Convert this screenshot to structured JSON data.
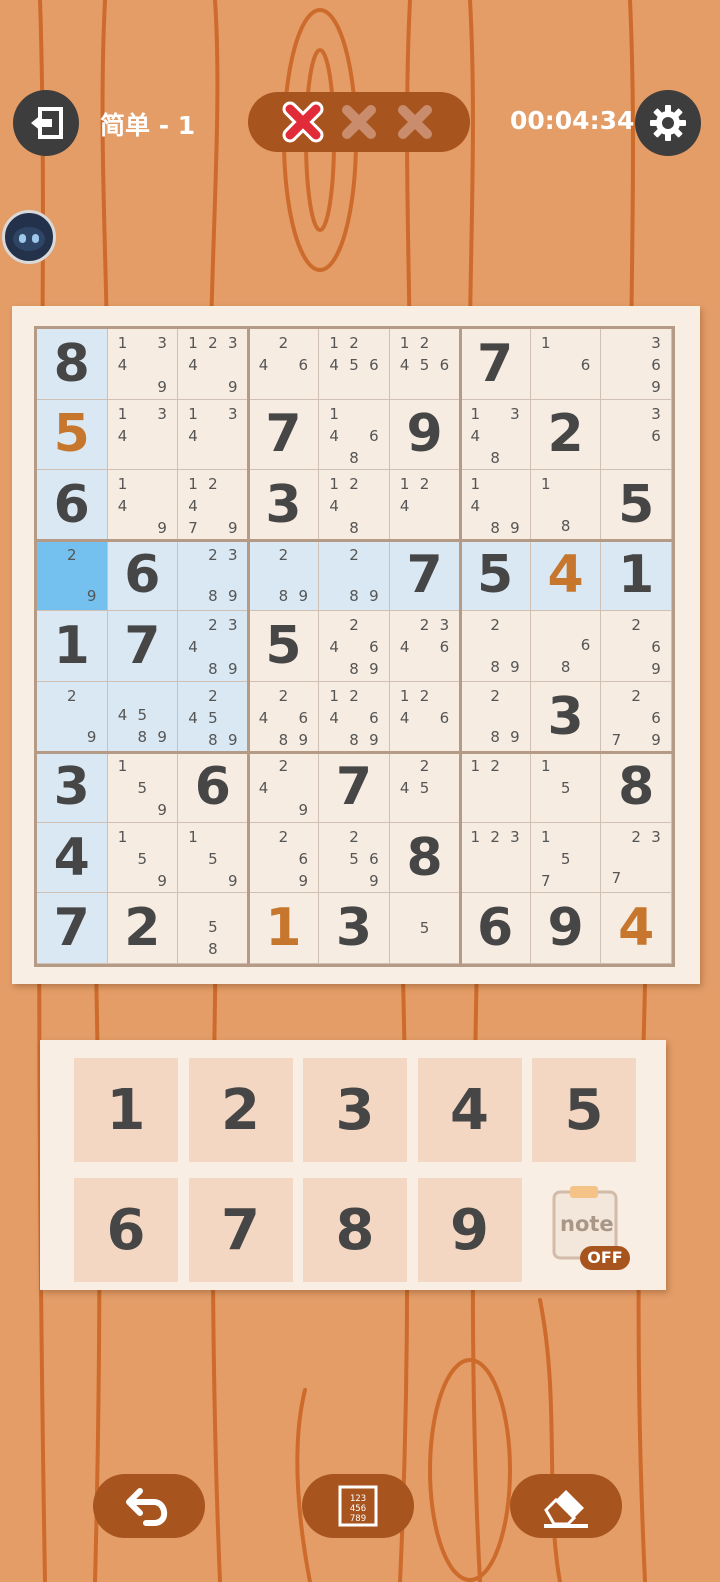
{
  "header": {
    "title": "简单 - 1",
    "timer": "00:04:34",
    "mistakes": [
      "active",
      "inactive",
      "inactive"
    ],
    "back_icon": "exit-icon",
    "settings_icon": "gear-icon"
  },
  "board": {
    "cells": [
      [
        {
          "v": "8"
        },
        {
          "n": "1,3,4,9"
        },
        {
          "n": "1,2,3,4,9"
        },
        {
          "n": "2,4,6"
        },
        {
          "n": "1,2,4,5,6"
        },
        {
          "n": "1,2,4,5,6"
        },
        {
          "v": "7"
        },
        {
          "n": "1,6"
        },
        {
          "n": "3,6,9"
        }
      ],
      [
        {
          "v": "5",
          "u": true
        },
        {
          "n": "1,3,4"
        },
        {
          "n": "1,3,4"
        },
        {
          "v": "7"
        },
        {
          "n": "1,4,6,8"
        },
        {
          "v": "9"
        },
        {
          "n": "1,3,4,8"
        },
        {
          "v": "2"
        },
        {
          "n": "3,6"
        }
      ],
      [
        {
          "v": "6"
        },
        {
          "n": "1,4,9"
        },
        {
          "n": "1,2,4,7,9"
        },
        {
          "v": "3"
        },
        {
          "n": "1,2,4,8"
        },
        {
          "n": "1,2,4"
        },
        {
          "n": "1,4,8,9"
        },
        {
          "n": "1,8"
        },
        {
          "v": "5"
        }
      ],
      [
        {
          "n": "2,9"
        },
        {
          "v": "6"
        },
        {
          "n": "2,3,8,9"
        },
        {
          "n": "2,8,9"
        },
        {
          "n": "2,8,9"
        },
        {
          "v": "7"
        },
        {
          "v": "5"
        },
        {
          "v": "4",
          "u": true
        },
        {
          "v": "1"
        }
      ],
      [
        {
          "v": "1"
        },
        {
          "v": "7"
        },
        {
          "n": "2,3,4,8,9"
        },
        {
          "v": "5"
        },
        {
          "n": "2,4,6,8,9"
        },
        {
          "n": "2,3,4,6"
        },
        {
          "n": "2,8,9"
        },
        {
          "n": "6,8"
        },
        {
          "n": "2,6,9"
        }
      ],
      [
        {
          "n": "2,9"
        },
        {
          "n": "4,5,8,9"
        },
        {
          "n": "2,4,5,8,9"
        },
        {
          "n": "2,4,6,8,9"
        },
        {
          "n": "1,2,4,6,8,9"
        },
        {
          "n": "1,2,4,6"
        },
        {
          "n": "2,8,9"
        },
        {
          "v": "3"
        },
        {
          "n": "2,6,7,9"
        }
      ],
      [
        {
          "v": "3"
        },
        {
          "n": "1,5,9"
        },
        {
          "v": "6"
        },
        {
          "n": "2,4,9"
        },
        {
          "v": "7"
        },
        {
          "n": "2,4,5"
        },
        {
          "n": "1,2"
        },
        {
          "n": "1,5"
        },
        {
          "v": "8"
        }
      ],
      [
        {
          "v": "4"
        },
        {
          "n": "1,5,9"
        },
        {
          "n": "1,5,9"
        },
        {
          "n": "2,6,9"
        },
        {
          "n": "2,5,6,9"
        },
        {
          "v": "8"
        },
        {
          "n": "1,2,3"
        },
        {
          "n": "1,5,7"
        },
        {
          "n": "2,3,7"
        }
      ],
      [
        {
          "v": "7"
        },
        {
          "v": "2"
        },
        {
          "n": "5,8"
        },
        {
          "v": "1",
          "u": true
        },
        {
          "v": "3"
        },
        {
          "n": "5"
        },
        {
          "v": "6"
        },
        {
          "v": "9"
        },
        {
          "v": "4",
          "u": true
        }
      ]
    ],
    "selected": [
      3,
      0
    ]
  },
  "keypad": {
    "keys": [
      "1",
      "2",
      "3",
      "4",
      "5",
      "6",
      "7",
      "8",
      "9"
    ],
    "note_label": "note",
    "note_state": "OFF"
  },
  "bottom": {
    "undo_icon": "undo-icon",
    "candidates_icon": "candidates-grid-icon",
    "erase_icon": "eraser-icon",
    "candidates_digits": "123456789"
  },
  "colors": {
    "given": "#464646",
    "user": "#c7772d",
    "highlight": "#d9e8f3",
    "selected": "#74c1ef",
    "accent": "#a7541e"
  }
}
